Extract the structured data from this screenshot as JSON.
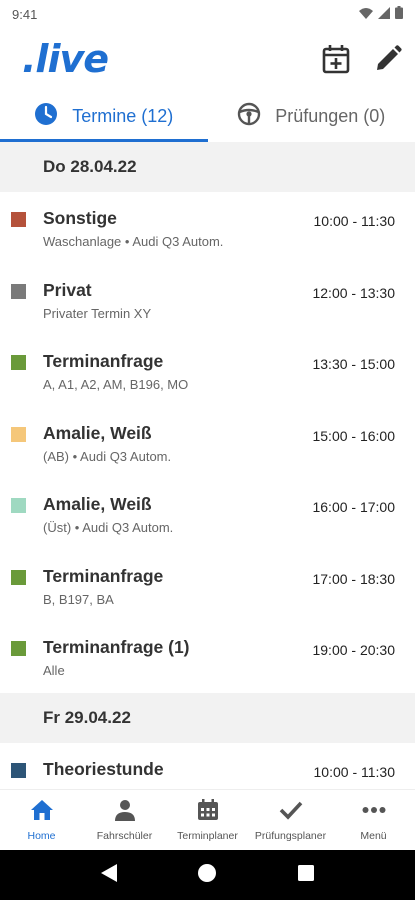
{
  "status_bar": {
    "time": "9:41"
  },
  "app_bar": {
    "logo": ".live"
  },
  "tabs": [
    {
      "label": "Termine (12)",
      "icon": "clock-icon",
      "active": true
    },
    {
      "label": "Prüfungen (0)",
      "icon": "steering-wheel-icon",
      "active": false
    }
  ],
  "days": [
    {
      "label": "Do 28.04.22",
      "appointments": [
        {
          "title": "Sonstige",
          "subtitle": "Waschanlage • Audi Q3 Autom.",
          "time": "10:00 - 11:30",
          "color": "#b5523b"
        },
        {
          "title": "Privat",
          "subtitle": "Privater Termin XY",
          "time": "12:00 - 13:30",
          "color": "#7a7a7a"
        },
        {
          "title": "Terminanfrage",
          "subtitle": "A, A1, A2, AM, B196, MO",
          "time": "13:30 - 15:00",
          "color": "#6a9a3a"
        },
        {
          "title": "Amalie, Weiß",
          "subtitle": "(AB) • Audi Q3 Autom.",
          "time": "15:00 - 16:00",
          "color": "#f5c77a"
        },
        {
          "title": "Amalie, Weiß",
          "subtitle": "(Üst) • Audi Q3 Autom.",
          "time": "16:00 - 17:00",
          "color": "#9fd9c1"
        },
        {
          "title": "Terminanfrage",
          "subtitle": "B, B197, BA",
          "time": "17:00 - 18:30",
          "color": "#6a9a3a"
        },
        {
          "title": "Terminanfrage (1)",
          "subtitle": "Alle",
          "time": "19:00 - 20:30",
          "color": "#6a9a3a"
        }
      ]
    },
    {
      "label": "Fr 29.04.22",
      "appointments": [
        {
          "title": "Theoriestunde",
          "subtitle": "",
          "time": "10:00 - 11:30",
          "color": "#2d5577"
        }
      ]
    }
  ],
  "bottom_nav": [
    {
      "label": "Home",
      "icon": "home-icon",
      "active": true
    },
    {
      "label": "Fahrschüler",
      "icon": "person-icon",
      "active": false
    },
    {
      "label": "Terminplaner",
      "icon": "calendar-icon",
      "active": false
    },
    {
      "label": "Prüfungsplaner",
      "icon": "check-icon",
      "active": false
    },
    {
      "label": "Menü",
      "icon": "more-icon",
      "active": false
    }
  ],
  "colors": {
    "accent": "#1f6fd1",
    "day_header_bg": "#f2f2f2"
  }
}
